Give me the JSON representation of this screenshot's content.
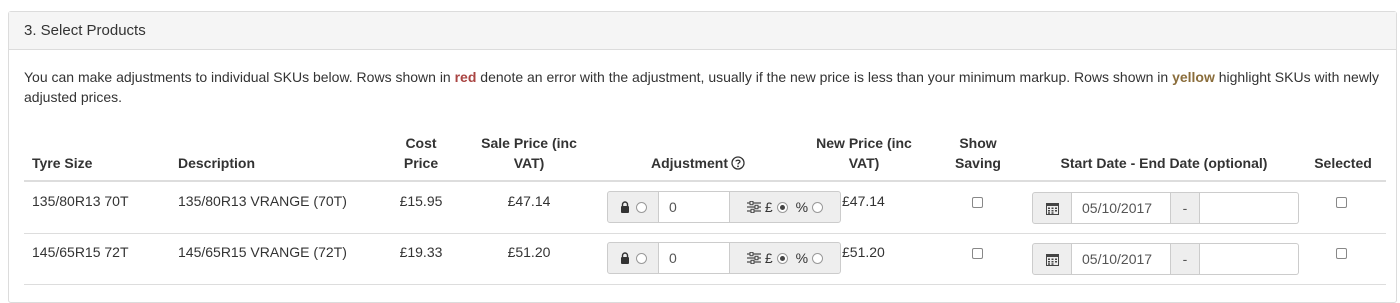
{
  "panel": {
    "title": "3. Select Products",
    "intro": {
      "part1": "You can make adjustments to individual SKUs below. Rows shown in ",
      "red": "red",
      "part2": " denote an error with the adjustment, usually if the new price is less than your minimum markup. Rows shown in ",
      "yellow": "yellow",
      "part3": " highlight SKUs with newly adjusted prices."
    }
  },
  "table": {
    "headers": {
      "tyre_size": "Tyre Size",
      "description": "Description",
      "cost_price_1": "Cost",
      "cost_price_2": "Price",
      "sale_price_1": "Sale Price (inc",
      "sale_price_2": "VAT)",
      "adjustment": "Adjustment",
      "new_price_1": "New Price (inc",
      "new_price_2": "VAT)",
      "show_saving_1": "Show",
      "show_saving_2": "Saving",
      "dates": "Start Date - End Date (optional)",
      "selected": "Selected"
    },
    "rows": [
      {
        "tyre_size": "135/80R13 70T",
        "description": "135/80R13 VRANGE (70T)",
        "cost_price": "£15.95",
        "sale_price": "£47.14",
        "adjustment_value": "0",
        "currency_symbol": "£",
        "percent_symbol": "%",
        "adjustment_mode": "£",
        "new_price": "£47.14",
        "show_saving": false,
        "start_date": "05/10/2017",
        "date_separator": "-",
        "end_date": "",
        "selected": false
      },
      {
        "tyre_size": "145/65R15 72T",
        "description": "145/65R15 VRANGE (72T)",
        "cost_price": "£19.33",
        "sale_price": "£51.20",
        "adjustment_value": "0",
        "currency_symbol": "£",
        "percent_symbol": "%",
        "adjustment_mode": "£",
        "new_price": "£51.20",
        "show_saving": false,
        "start_date": "05/10/2017",
        "date_separator": "-",
        "end_date": "",
        "selected": false
      }
    ]
  },
  "icons": {
    "lock": "lock-icon",
    "sliders": "sliders-icon",
    "calendar": "calendar-icon",
    "help": "help-circle-icon"
  }
}
